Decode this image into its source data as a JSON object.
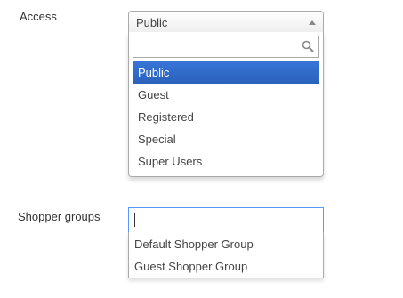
{
  "access": {
    "label": "Access",
    "selected": "Public",
    "search_value": "",
    "options": [
      {
        "label": "Public",
        "highlighted": true
      },
      {
        "label": "Guest",
        "highlighted": false
      },
      {
        "label": "Registered",
        "highlighted": false
      },
      {
        "label": "Special",
        "highlighted": false
      },
      {
        "label": "Super Users",
        "highlighted": false
      }
    ]
  },
  "shopper_groups": {
    "label": "Shopper groups",
    "input_value": "",
    "results": [
      {
        "label": "Default Shopper Group"
      },
      {
        "label": "Guest Shopper Group"
      }
    ]
  },
  "colors": {
    "highlight": "#3875d7",
    "focus_border": "#5897fb"
  },
  "icons": {
    "search": "search-icon",
    "arrow": "chevron-up-icon"
  }
}
